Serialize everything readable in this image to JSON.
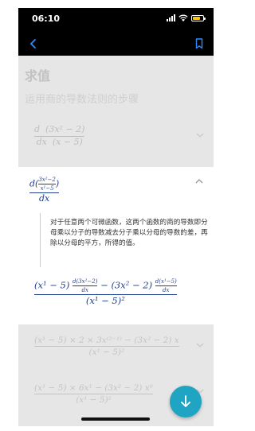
{
  "status_bar": {
    "time": "06:10"
  },
  "header": {
    "title": "求值",
    "subtitle": "运用商的导数法则的步骤"
  },
  "steps": {
    "step1": {
      "d": "d",
      "dx": "dx",
      "num": "(3x² − 2)",
      "den": "(x − 5)"
    },
    "step2": {
      "d_open": "d(",
      "num": "3x²−2",
      "den": "x¹−5",
      "close": ")",
      "dx": "dx",
      "explanation": "对于任意两个可微函数，这两个函数的商的导数即分母乘以分子的导数减去分子乘以分母的导数的差，再除以分母的平方，所得的值。",
      "result": {
        "part1": "(x¹ − 5)",
        "d_num": "d(3x²−2)",
        "dx": "dx",
        "minus": "−",
        "part2": "(3x² − 2)",
        "d_den": "d(x¹−5)",
        "den": "(x¹ − 5)²"
      }
    },
    "step3": {
      "num": "(x¹ − 5) × 2 × 3x⁽²⁻¹⁾ − (3x² − 2) x",
      "den": "(x¹ − 5)²"
    },
    "step4": {
      "num": "(x¹ − 5) × 6x¹ − (3x² − 2) x⁰",
      "den": "(x¹ − 5)²"
    }
  },
  "colors": {
    "accent": "#1f3f8f",
    "fab": "#1fa4c3",
    "dim": "#e6e6e6"
  },
  "icons": {
    "back": "chevron-left-icon",
    "bookmark": "bookmark-icon",
    "scroll_down": "arrow-down-icon"
  }
}
